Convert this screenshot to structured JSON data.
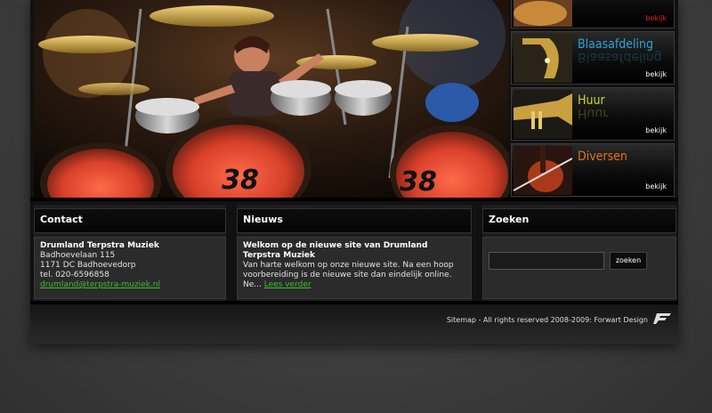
{
  "categories": [
    {
      "title": "",
      "more": "bekijk",
      "color": "#d21a1a",
      "more_color": "#e02020"
    },
    {
      "title": "Blaasafdeling",
      "more": "bekijk",
      "color": "#2aa4d8"
    },
    {
      "title": "Huur",
      "more": "bekijk",
      "color": "#c8d82a"
    },
    {
      "title": "Diversen",
      "more": "bekijk",
      "color": "#e8701a"
    }
  ],
  "contact": {
    "heading": "Contact",
    "company": "Drumland Terpstra Muziek",
    "street": "Badhoevelaan 115",
    "city": "1171 DC Badhoevedorp",
    "phone": "tel. 020-6596858",
    "email": "drumland@terpstra-muziek.nl"
  },
  "news": {
    "heading": "Nieuws",
    "title": "Welkom op de nieuwe site van Drumland Terpstra Muziek",
    "text": "Van harte welkom op onze nieuwe site. Na een hoop voorbereiding is de nieuwe site dan eindelijk online. Ne...",
    "read_more": "Lees verder"
  },
  "search": {
    "heading": "Zoeken",
    "input_value": "",
    "button_label": "zoeken"
  },
  "footer": {
    "text": "Sitemap - All rights reserved 2008-2009: Forwart Design"
  },
  "hero": {
    "drum_number": "38"
  }
}
